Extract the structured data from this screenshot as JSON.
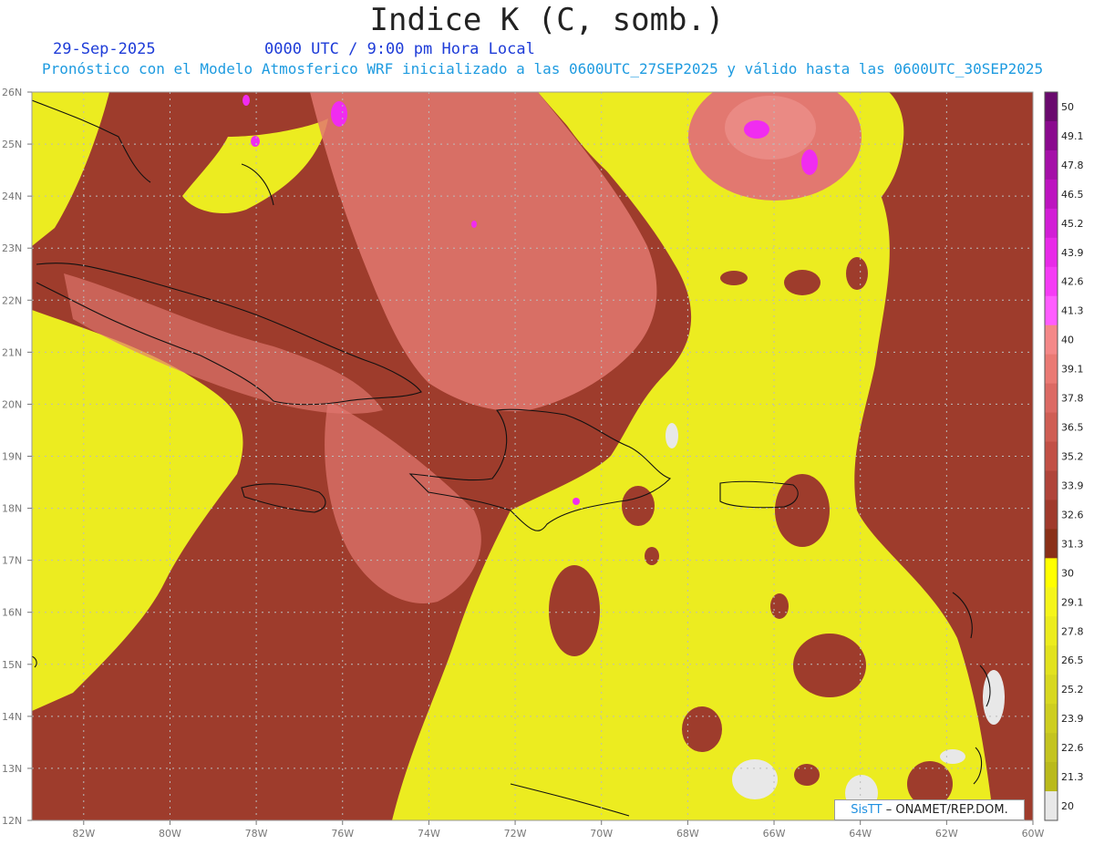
{
  "header": {
    "title": "Indice K (C, somb.)",
    "date": "29-Sep-2025",
    "time": "0000 UTC / 9:00 pm Hora Local",
    "description": "Pronóstico con el Modelo Atmosferico WRF inicializado a las 0600UTC_27SEP2025 y válido hasta las  0600UTC_30SEP2025"
  },
  "map": {
    "lat_labels": [
      "26N",
      "25N",
      "24N",
      "23N",
      "22N",
      "21N",
      "20N",
      "19N",
      "18N",
      "17N",
      "16N",
      "15N",
      "14N",
      "13N",
      "12N"
    ],
    "lon_labels": [
      "82W",
      "80W",
      "78W",
      "76W",
      "74W",
      "72W",
      "70W",
      "68W",
      "66W",
      "64W",
      "62W",
      "60W"
    ]
  },
  "colorbar": {
    "levels": [
      "50",
      "49.1",
      "47.8",
      "46.5",
      "45.2",
      "43.9",
      "42.6",
      "41.3",
      "40",
      "39.1",
      "37.8",
      "36.5",
      "35.2",
      "33.9",
      "32.6",
      "31.3",
      "30",
      "29.1",
      "27.8",
      "26.5",
      "25.2",
      "23.9",
      "22.6",
      "21.3",
      "20"
    ],
    "colors": [
      "#6a0a6e",
      "#8a0a8e",
      "#a510a8",
      "#bd14c0",
      "#d21ed6",
      "#e82ae8",
      "#f53cf5",
      "#ff5cff",
      "#f48888",
      "#ea7a74",
      "#dc6a64",
      "#cf5e54",
      "#c25046",
      "#b0443a",
      "#a03a2c",
      "#8a3018",
      "#ffff00",
      "#f5f51a",
      "#ecec1e",
      "#e2e21e",
      "#d8d820",
      "#cece20",
      "#c4c420",
      "#baba1c",
      "#e8e8e8"
    ]
  },
  "credit": {
    "brand": "SisTT",
    "org": "– ONAMET/REP.DOM."
  },
  "colors": {
    "low": "#e8e8e8",
    "yellow": "#ecec20",
    "brown": "#9e3c2c",
    "salmon": "#e27870",
    "magenta": "#f02cf0"
  }
}
